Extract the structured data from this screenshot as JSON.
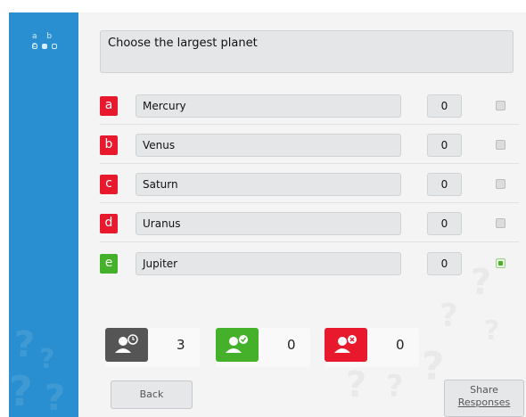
{
  "question": {
    "text": "Choose the largest planet"
  },
  "answers": [
    {
      "letter": "a",
      "text": "Mercury",
      "count": "0",
      "checked": false,
      "color": "#e8192c"
    },
    {
      "letter": "b",
      "text": "Venus",
      "count": "0",
      "checked": false,
      "color": "#e8192c"
    },
    {
      "letter": "c",
      "text": "Saturn",
      "count": "0",
      "checked": false,
      "color": "#e8192c"
    },
    {
      "letter": "d",
      "text": "Uranus",
      "count": "0",
      "checked": false,
      "color": "#e8192c"
    },
    {
      "letter": "e",
      "text": "Jupiter",
      "count": "0",
      "checked": true,
      "color": "#45b02a"
    }
  ],
  "stats": {
    "pending": {
      "value": "3",
      "icon": "user-clock-icon",
      "color": "#555555"
    },
    "correct": {
      "value": "0",
      "icon": "user-check-icon",
      "color": "#45b02a"
    },
    "wrong": {
      "value": "0",
      "icon": "user-cross-icon",
      "color": "#e8192c"
    }
  },
  "buttons": {
    "back": "Back",
    "share_line1": "Share",
    "share_line2": "Responses"
  },
  "sidebar": {
    "logo_letters": "a b c",
    "logo_icon": "abc-grid-icon"
  }
}
